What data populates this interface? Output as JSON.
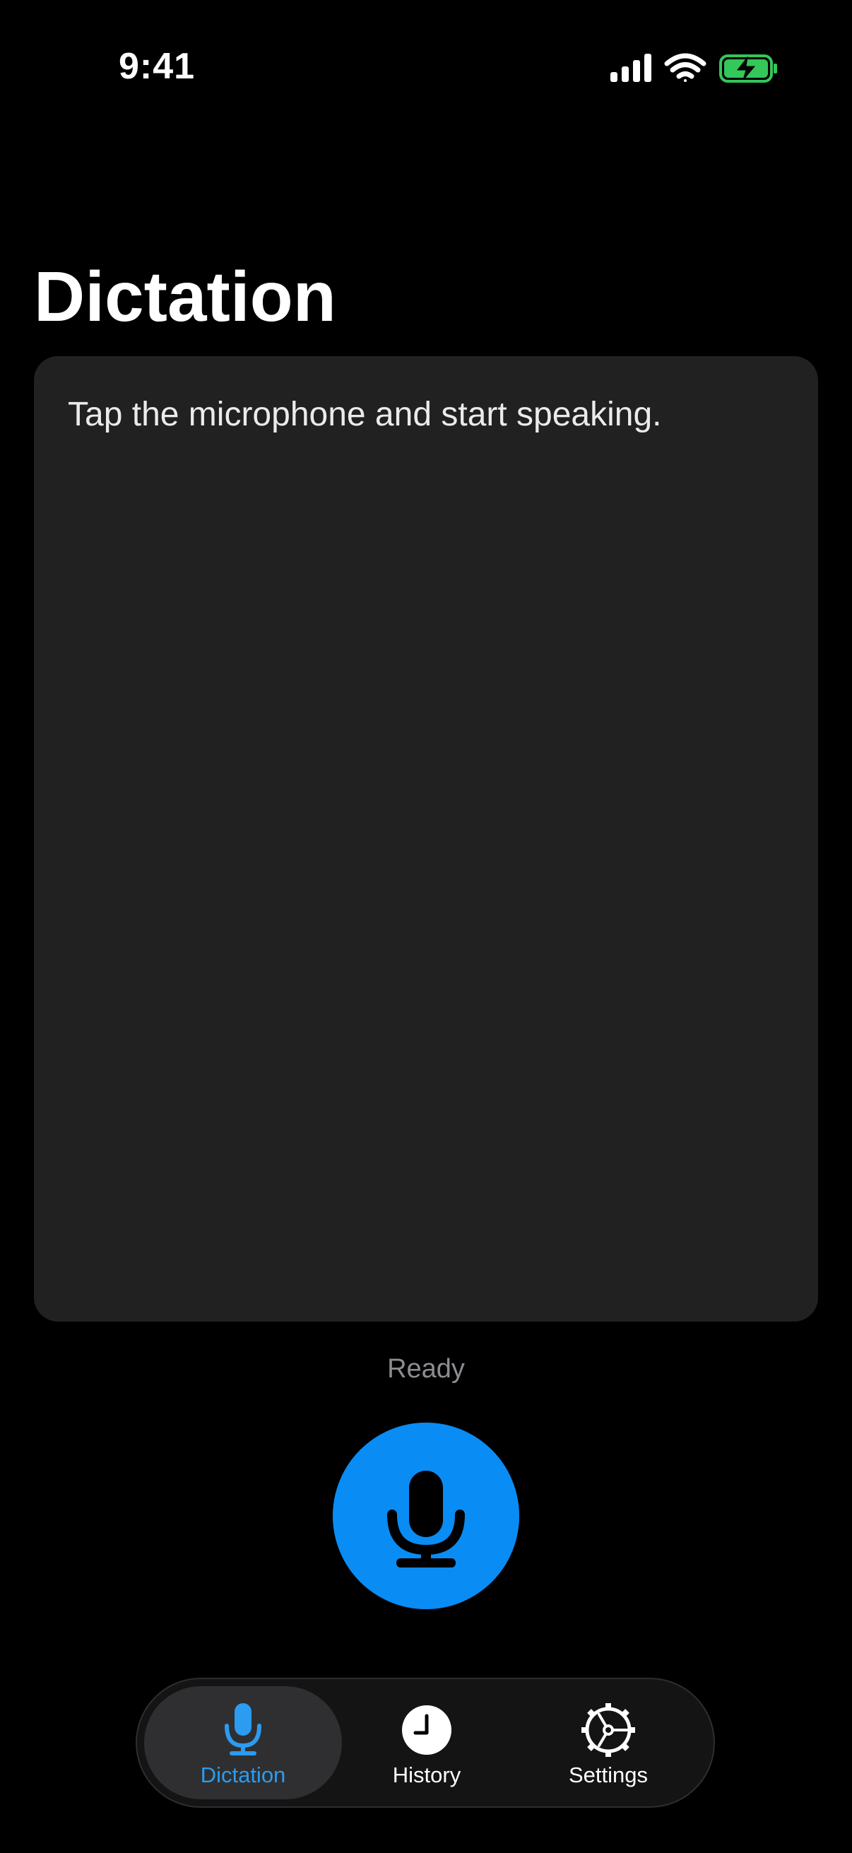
{
  "status_bar": {
    "time": "9:41"
  },
  "title": "Dictation",
  "transcript": {
    "placeholder": "Tap the microphone and start speaking."
  },
  "status": "Ready",
  "mic_button": {
    "icon": "microphone-icon",
    "color": "#0a8cf5"
  },
  "tabs": [
    {
      "label": "Dictation",
      "icon": "microphone-icon",
      "active": true
    },
    {
      "label": "History",
      "icon": "clock-icon",
      "active": false
    },
    {
      "label": "Settings",
      "icon": "gear-icon",
      "active": false
    }
  ],
  "colors": {
    "accent": "#2b9cf0",
    "panel": "#212121",
    "battery": "#34c759"
  }
}
